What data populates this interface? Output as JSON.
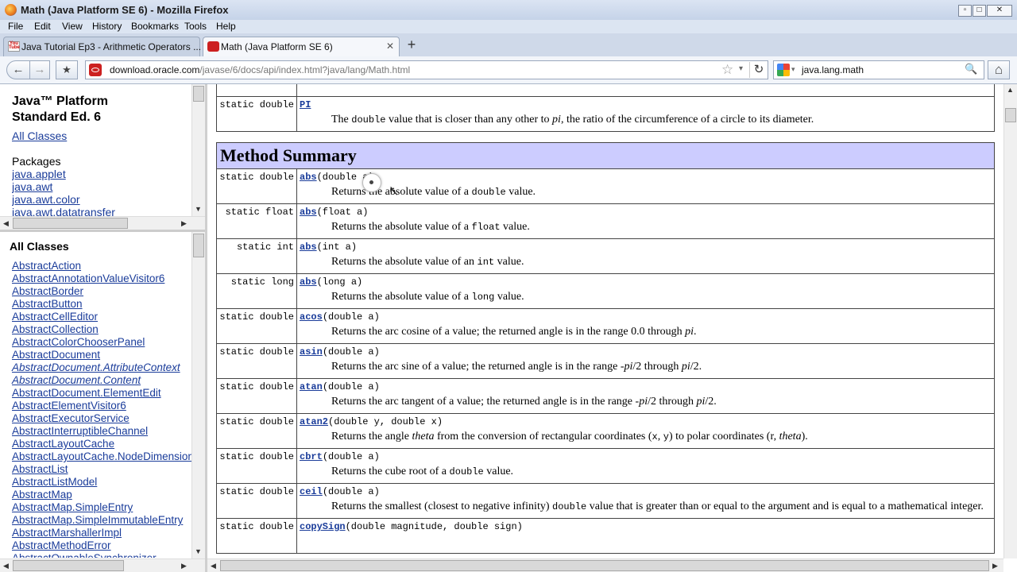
{
  "window": {
    "title": "Math (Java Platform SE 6) - Mozilla Firefox",
    "buttons": {
      "minimize": "▫",
      "maximize": "□",
      "close": "✕"
    }
  },
  "menu": [
    "File",
    "Edit",
    "View",
    "History",
    "Bookmarks",
    "Tools",
    "Help"
  ],
  "tabs": [
    {
      "label": "Java Tutorial Ep3 - Arithmetic Operators ...",
      "icon": "youtube-icon",
      "active": false
    },
    {
      "label": "Math (Java Platform SE 6)",
      "icon": "oracle-icon",
      "active": true
    }
  ],
  "newtab_label": "+",
  "nav": {
    "back": "←",
    "forward": "→",
    "bookmark": "★",
    "url_host": "download.oracle.com",
    "url_path": "/javase/6/docs/api/index.html?java/lang/Math.html",
    "star": "☆",
    "dropdown": "▾",
    "reload": "↻",
    "search_value": "java.lang.math",
    "search_icon": "🔍",
    "home": "⌂"
  },
  "left_top": {
    "title_line1": "Java™ Platform",
    "title_line2": "Standard Ed. 6",
    "all_classes": "All Classes",
    "packages_heading": "Packages",
    "packages": [
      "java.applet",
      "java.awt",
      "java.awt.color",
      "java.awt.datatransfer"
    ]
  },
  "left_bottom": {
    "heading": "All Classes",
    "classes": [
      {
        "name": "AbstractAction",
        "italic": false
      },
      {
        "name": "AbstractAnnotationValueVisitor6",
        "italic": false
      },
      {
        "name": "AbstractBorder",
        "italic": false
      },
      {
        "name": "AbstractButton",
        "italic": false
      },
      {
        "name": "AbstractCellEditor",
        "italic": false
      },
      {
        "name": "AbstractCollection",
        "italic": false
      },
      {
        "name": "AbstractColorChooserPanel",
        "italic": false
      },
      {
        "name": "AbstractDocument",
        "italic": false
      },
      {
        "name": "AbstractDocument.AttributeContext",
        "italic": true
      },
      {
        "name": "AbstractDocument.Content",
        "italic": true
      },
      {
        "name": "AbstractDocument.ElementEdit",
        "italic": false
      },
      {
        "name": "AbstractElementVisitor6",
        "italic": false
      },
      {
        "name": "AbstractExecutorService",
        "italic": false
      },
      {
        "name": "AbstractInterruptibleChannel",
        "italic": false
      },
      {
        "name": "AbstractLayoutCache",
        "italic": false
      },
      {
        "name": "AbstractLayoutCache.NodeDimensions",
        "italic": false
      },
      {
        "name": "AbstractList",
        "italic": false
      },
      {
        "name": "AbstractListModel",
        "italic": false
      },
      {
        "name": "AbstractMap",
        "italic": false
      },
      {
        "name": "AbstractMap.SimpleEntry",
        "italic": false
      },
      {
        "name": "AbstractMap.SimpleImmutableEntry",
        "italic": false
      },
      {
        "name": "AbstractMarshallerImpl",
        "italic": false
      },
      {
        "name": "AbstractMethodError",
        "italic": false
      },
      {
        "name": "AbstractOwnableSynchronizer",
        "italic": false
      }
    ]
  },
  "field_row": {
    "modifier": "static double",
    "name": "PI",
    "desc_html": "The <code>double</code> value that is closer than any other to <i>pi</i>, the ratio of the circumference of a circle to its diameter."
  },
  "method_summary": {
    "heading": "Method Summary",
    "rows": [
      {
        "modifier": "static double",
        "name": "abs",
        "params": "(double a)",
        "desc_html": "Returns the absolute value of a <code>double</code> value."
      },
      {
        "modifier": "static float",
        "name": "abs",
        "params": "(float a)",
        "desc_html": "Returns the absolute value of a <code>float</code> value."
      },
      {
        "modifier": "static int",
        "name": "abs",
        "params": "(int a)",
        "desc_html": "Returns the absolute value of an <code>int</code> value."
      },
      {
        "modifier": "static long",
        "name": "abs",
        "params": "(long a)",
        "desc_html": "Returns the absolute value of a <code>long</code> value."
      },
      {
        "modifier": "static double",
        "name": "acos",
        "params": "(double a)",
        "desc_html": "Returns the arc cosine of a value; the returned angle is in the range 0.0 through <i>pi</i>."
      },
      {
        "modifier": "static double",
        "name": "asin",
        "params": "(double a)",
        "desc_html": "Returns the arc sine of a value; the returned angle is in the range -<i>pi</i>/2 through <i>pi</i>/2."
      },
      {
        "modifier": "static double",
        "name": "atan",
        "params": "(double a)",
        "desc_html": "Returns the arc tangent of a value; the returned angle is in the range -<i>pi</i>/2 through <i>pi</i>/2."
      },
      {
        "modifier": "static double",
        "name": "atan2",
        "params": "(double y, double x)",
        "desc_html": "Returns the angle <i>theta</i> from the conversion of rectangular coordinates (<code>x</code>,&nbsp;<code>y</code>) to polar coordinates (r,&nbsp;<i>theta</i>)."
      },
      {
        "modifier": "static double",
        "name": "cbrt",
        "params": "(double a)",
        "desc_html": "Returns the cube root of a <code>double</code> value."
      },
      {
        "modifier": "static double",
        "name": "ceil",
        "params": "(double a)",
        "desc_html": "Returns the smallest (closest to negative infinity) <code>double</code> value that is greater than or equal to the argument and is equal to a mathematical integer."
      },
      {
        "modifier": "static double",
        "name": "copySign",
        "params": "(double magnitude, double sign)",
        "desc_html": ""
      }
    ]
  },
  "colors": {
    "link": "#1a3c9a",
    "summary_header_bg": "#ccccff"
  }
}
